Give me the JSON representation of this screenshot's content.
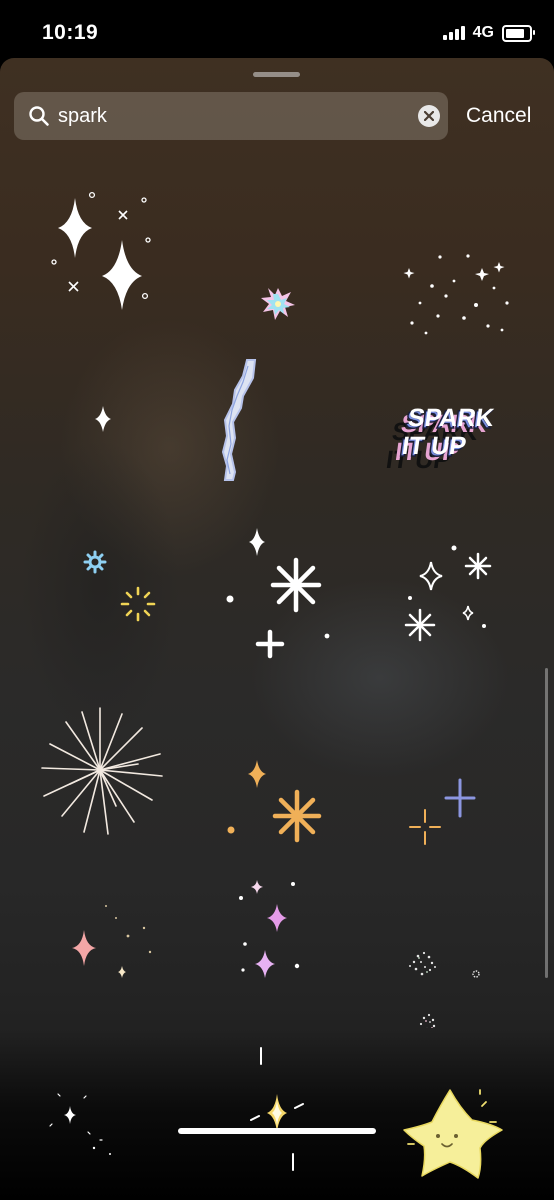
{
  "status_bar": {
    "time": "10:19",
    "network": "4G"
  },
  "search": {
    "value": "spark",
    "placeholder": "Search",
    "cancel_label": "Cancel"
  },
  "stickers": [
    {
      "name": "sparkles-white"
    },
    {
      "name": "holographic-star"
    },
    {
      "name": "star-dots"
    },
    {
      "name": "single-twinkle"
    },
    {
      "name": "lightning-bolt"
    },
    {
      "name": "spark-it-up-text",
      "text": "SPARK IT UP"
    },
    {
      "name": "color-bursts"
    },
    {
      "name": "white-stars-cluster"
    },
    {
      "name": "outline-diamond-stars"
    },
    {
      "name": "firework-burst"
    },
    {
      "name": "orange-stars"
    },
    {
      "name": "lavender-cross-star"
    },
    {
      "name": "pink-twinkle"
    },
    {
      "name": "pink-purple-sparkles"
    },
    {
      "name": "glitter-circles"
    },
    {
      "name": "tiny-twinkles"
    },
    {
      "name": "gold-shine"
    },
    {
      "name": "smiling-star"
    }
  ],
  "colors": {
    "sheet_top": "#3f3022",
    "white": "#ffffff",
    "orange": "#f0b058",
    "pink": "#f3a6a6",
    "lavender": "#8c96e0",
    "yellow_star": "#f6ef9a"
  }
}
